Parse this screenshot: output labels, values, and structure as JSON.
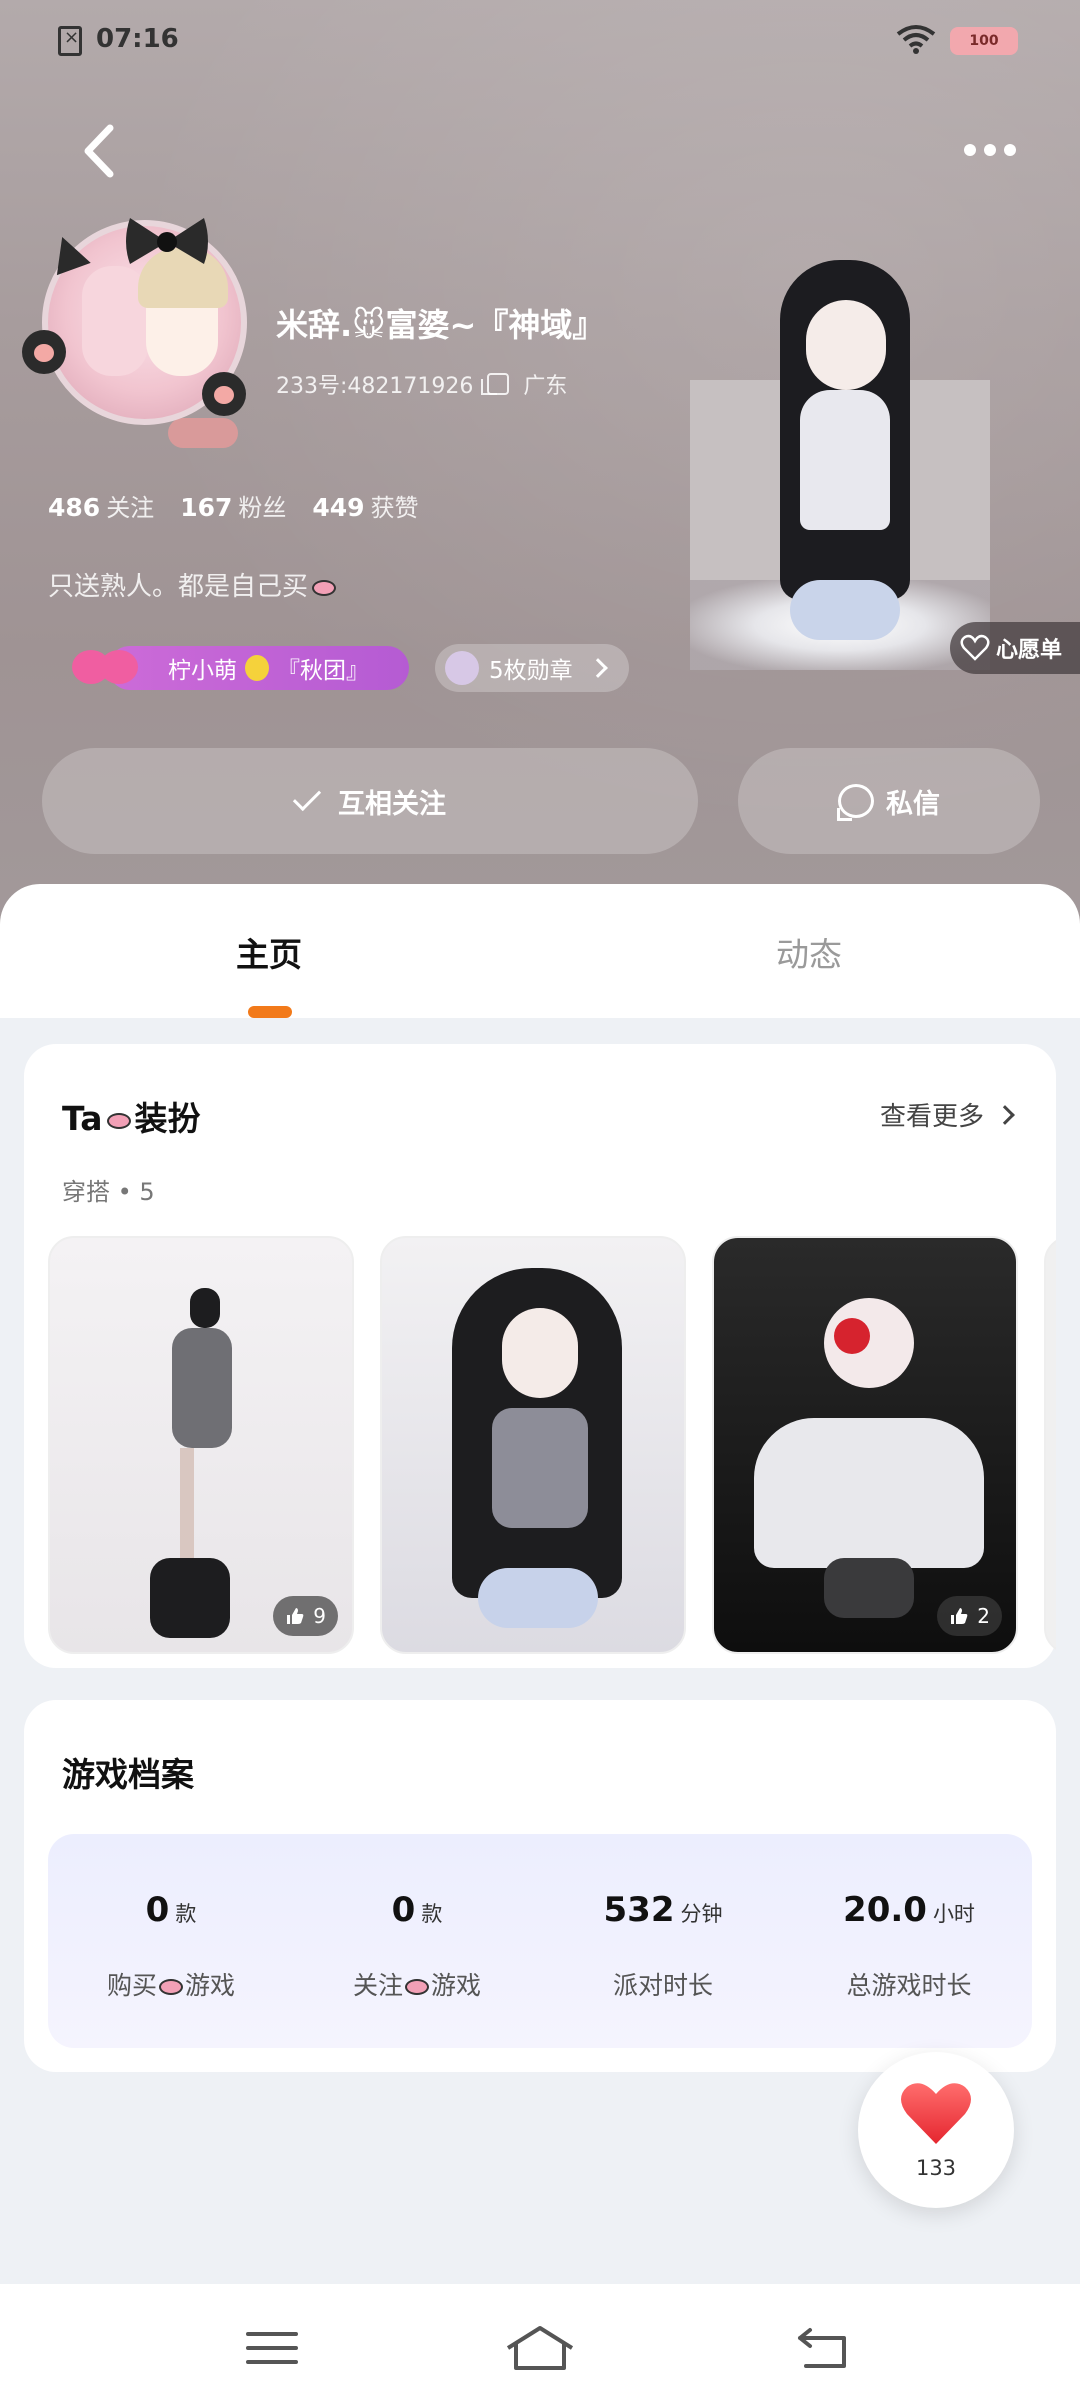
{
  "status_bar": {
    "time": "07:16",
    "battery": "100"
  },
  "profile": {
    "nickname": "米辞.🐭富婆~『神域』",
    "uid": "233号:482171926",
    "location": "广东",
    "stats": [
      {
        "value": "486",
        "label": "关注"
      },
      {
        "value": "167",
        "label": "粉丝"
      },
      {
        "value": "449",
        "label": "获赞"
      }
    ],
    "bio": "只送熟人。都是自己买",
    "family_tag": "柠小萌",
    "family_suffix": "『秋团』",
    "medals": "5枚勋章",
    "wishlist": "心愿单"
  },
  "actions": {
    "follow": "互相关注",
    "message": "私信"
  },
  "tabs": [
    {
      "label": "主页"
    },
    {
      "label": "动态"
    }
  ],
  "dress_up": {
    "title_prefix": "Ta",
    "title_suffix": "装扮",
    "see_more": "查看更多",
    "outfit_label": "穿搭",
    "outfit_count": "5",
    "outfits": [
      {
        "likes": "9"
      },
      {
        "likes": ""
      },
      {
        "likes": "2"
      }
    ]
  },
  "game_archive": {
    "title": "游戏档案",
    "stats": [
      {
        "value": "0",
        "unit": "款",
        "label_prefix": "购买",
        "label_suffix": "游戏"
      },
      {
        "value": "0",
        "unit": "款",
        "label_prefix": "关注",
        "label_suffix": "游戏"
      },
      {
        "value": "532",
        "unit": "分钟",
        "label": "派对时长"
      },
      {
        "value": "20.0",
        "unit": "小时",
        "label": "总游戏时长"
      }
    ]
  },
  "floating_like": {
    "count": "133"
  },
  "colors": {
    "accent": "#f27a1a",
    "family_pill": "#c463d6",
    "like_heart": "#f0444d"
  },
  "icons": [
    "back-icon",
    "more-icon",
    "copy-icon",
    "check-icon",
    "chat-icon",
    "chevron-right-icon",
    "thumb-up-icon",
    "heart-icon",
    "menu-icon",
    "home-icon",
    "back-nav-icon"
  ]
}
